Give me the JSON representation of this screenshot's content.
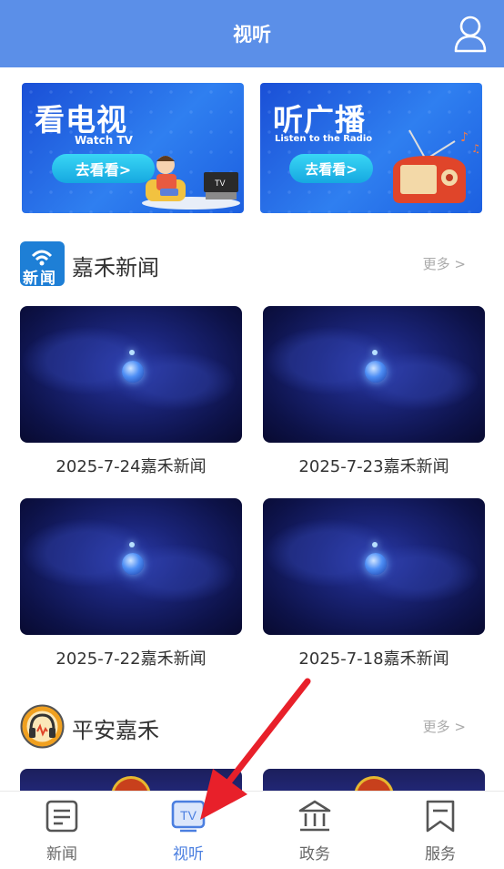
{
  "header": {
    "title": "视听"
  },
  "banners": [
    {
      "title": "看电视",
      "subtitle": "Watch TV",
      "button": "去看看>"
    },
    {
      "title": "听广播",
      "subtitle": "Listen to the Radio",
      "button": "去看看>"
    }
  ],
  "sections": [
    {
      "title": "嘉禾新闻",
      "more": "更多 >",
      "icon_text": "新闻",
      "videos": [
        {
          "label": "2025-7-24嘉禾新闻"
        },
        {
          "label": "2025-7-23嘉禾新闻"
        },
        {
          "label": "2025-7-22嘉禾新闻"
        },
        {
          "label": "2025-7-18嘉禾新闻"
        }
      ]
    },
    {
      "title": "平安嘉禾",
      "more": "更多 >"
    }
  ],
  "tabbar": {
    "items": [
      {
        "label": "新闻",
        "icon": "news-icon"
      },
      {
        "label": "视听",
        "icon": "tv-icon",
        "icon_text": "TV"
      },
      {
        "label": "政务",
        "icon": "government-icon"
      },
      {
        "label": "服务",
        "icon": "service-icon"
      }
    ],
    "active": "视听"
  },
  "colors": {
    "accent": "#5b8fe8",
    "active_tab": "#4b7fe0",
    "annotation": "#e8202a"
  }
}
